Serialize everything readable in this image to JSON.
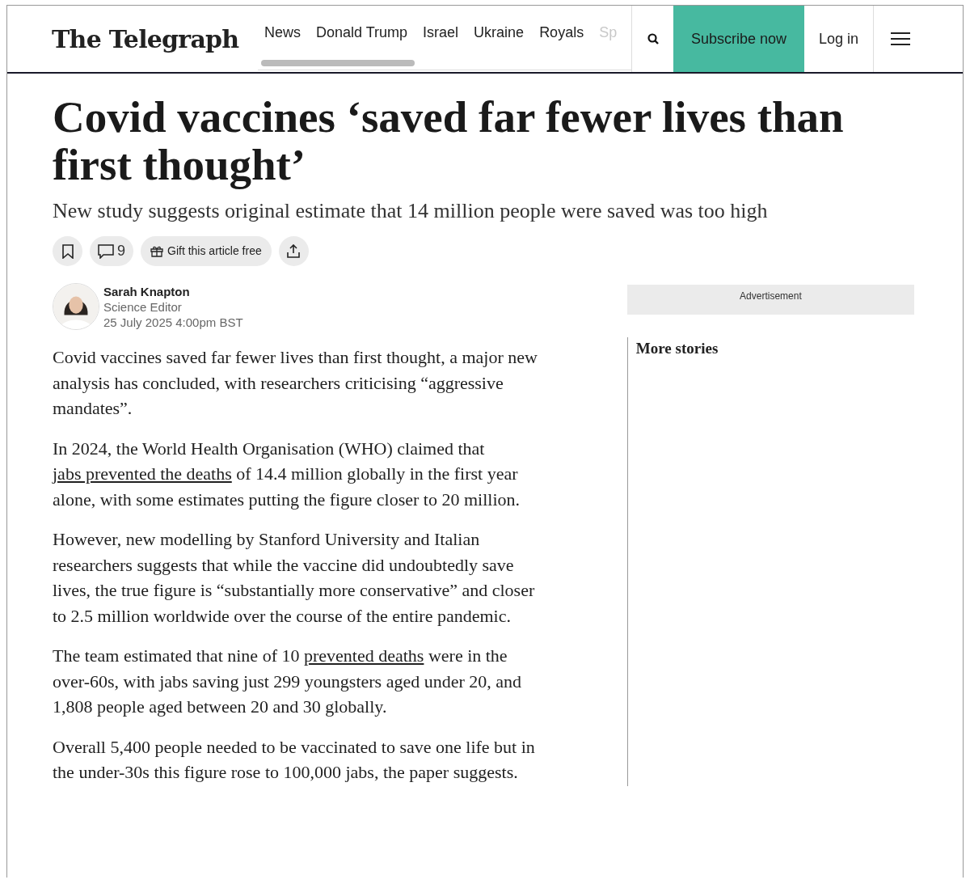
{
  "header": {
    "logo": "The Telegraph",
    "nav": [
      {
        "label": "News",
        "faded": false
      },
      {
        "label": "Donald Trump",
        "faded": false
      },
      {
        "label": "Israel",
        "faded": false
      },
      {
        "label": "Ukraine",
        "faded": false
      },
      {
        "label": "Royals",
        "faded": false
      },
      {
        "label": "Sp",
        "faded": true
      }
    ],
    "subscribe": "Subscribe now",
    "login": "Log in"
  },
  "article": {
    "headline": "Covid vaccines ‘saved far fewer lives than first thought’",
    "standfirst": "New study suggests original estimate that 14 million people were saved was too high",
    "actions": {
      "comments": "9",
      "gift": "Gift this article free"
    },
    "author": {
      "name": "Sarah Knapton",
      "role": "Science Editor",
      "date": "25 July 2025 4:00pm BST"
    },
    "paragraphs": [
      [
        {
          "kind": "text",
          "text": "Covid vaccines saved far fewer lives than first thought, a major new analysis has concluded, with researchers criticising “aggressive mandates”."
        }
      ],
      [
        {
          "kind": "text",
          "text": "In 2024, the World Health Organisation (WHO) claimed that "
        },
        {
          "kind": "link",
          "text": "jabs prevented the deaths"
        },
        {
          "kind": "text",
          "text": " of 14.4 million globally in the first year alone, with some estimates putting the figure closer to 20 million."
        }
      ],
      [
        {
          "kind": "text",
          "text": "However, new modelling by Stanford University and Italian researchers suggests that while the vaccine did undoubtedly save lives, the true figure is “substantially more conservative” and closer to 2.5 million worldwide over the course of the entire pandemic."
        }
      ],
      [
        {
          "kind": "text",
          "text": "The team estimated that nine of 10 "
        },
        {
          "kind": "link",
          "text": "prevented deaths"
        },
        {
          "kind": "text",
          "text": " were in the over-60s, with jabs saving just 299 youngsters aged under 20, and 1,808 people aged between 20 and 30 globally."
        }
      ],
      [
        {
          "kind": "text",
          "text": "Overall 5,400 people needed to be vaccinated to save one life but in the under-30s this figure rose to 100,000 jabs, the paper suggests."
        }
      ]
    ]
  },
  "sidebar": {
    "advertisement": "Advertisement",
    "more_stories": "More stories"
  }
}
